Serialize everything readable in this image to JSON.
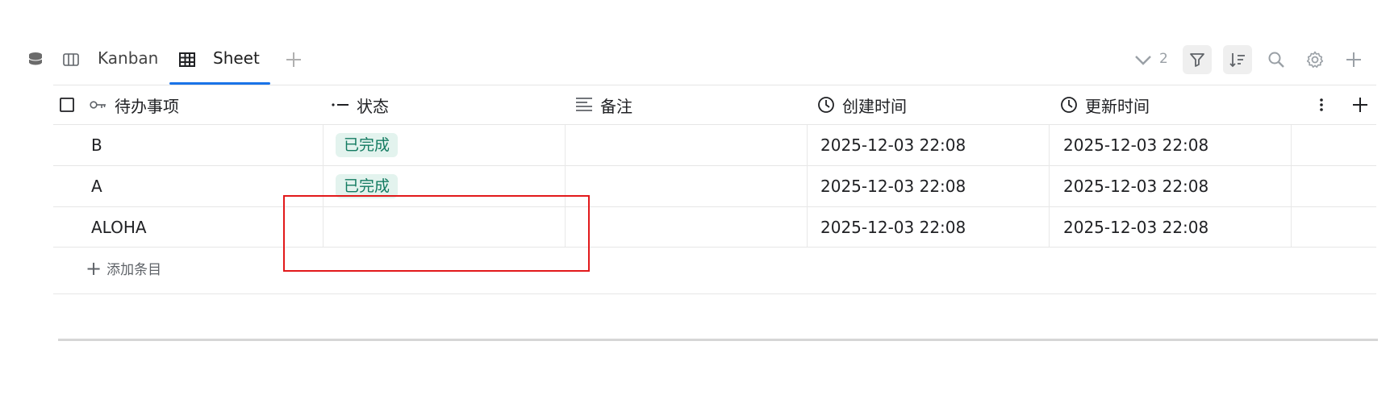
{
  "tabs": [
    {
      "label": "Kanban",
      "icon": "columns-icon"
    },
    {
      "label": "Sheet",
      "icon": "table-icon",
      "active": true
    }
  ],
  "toolbar": {
    "collapse_count": "2"
  },
  "table": {
    "columns": [
      {
        "label": "待办事项",
        "icon": "key-icon"
      },
      {
        "label": "状态",
        "icon": "select-icon"
      },
      {
        "label": "备注",
        "icon": "text-icon"
      },
      {
        "label": "创建时间",
        "icon": "clock-icon"
      },
      {
        "label": "更新时间",
        "icon": "clock-icon"
      }
    ],
    "rows": [
      {
        "title": "B",
        "status": "已完成",
        "note": "",
        "created": "2025-12-03 22:08",
        "updated": "2025-12-03 22:08"
      },
      {
        "title": "A",
        "status": "已完成",
        "note": "",
        "created": "2025-12-03 22:08",
        "updated": "2025-12-03 22:08"
      },
      {
        "title": "ALOHA",
        "status": "",
        "note": "",
        "created": "2025-12-03 22:08",
        "updated": "2025-12-03 22:08"
      }
    ],
    "add_row_label": "添加条目"
  },
  "colors": {
    "accent": "#1a73e8",
    "status_bg": "#e3f3ee",
    "status_text": "#137b61",
    "highlight": "#e2191b"
  }
}
